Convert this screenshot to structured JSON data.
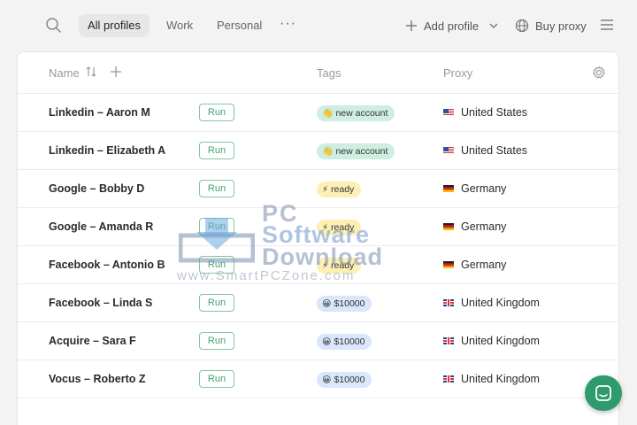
{
  "topbar": {
    "search_icon": "search-icon",
    "tabs": [
      {
        "label": "All profiles",
        "active": true
      },
      {
        "label": "Work",
        "active": false
      },
      {
        "label": "Personal",
        "active": false
      }
    ],
    "more_label": "···",
    "add_profile_label": "Add profile",
    "buy_proxy_label": "Buy proxy"
  },
  "table": {
    "columns": {
      "name": "Name",
      "tags": "Tags",
      "proxy": "Proxy"
    },
    "run_label": "Run",
    "rows": [
      {
        "name": "Linkedin – Aaron M",
        "tag": "new account",
        "tag_icon": "👋",
        "tag_color": "#cdeee0",
        "country": "United States",
        "flag": "us"
      },
      {
        "name": "Linkedin – Elizabeth A",
        "tag": "new account",
        "tag_icon": "👋",
        "tag_color": "#cdeee0",
        "country": "United States",
        "flag": "us"
      },
      {
        "name": "Google – Bobby D",
        "tag": "ready",
        "tag_icon": "⚡",
        "tag_color": "#fdf0b5",
        "country": "Germany",
        "flag": "de"
      },
      {
        "name": "Google – Amanda R",
        "tag": "ready",
        "tag_icon": "⚡",
        "tag_color": "#fdf0b5",
        "country": "Germany",
        "flag": "de"
      },
      {
        "name": "Facebook – Antonio B",
        "tag": "ready",
        "tag_icon": "⚡",
        "tag_color": "#fdf0b5",
        "country": "Germany",
        "flag": "de"
      },
      {
        "name": "Facebook – Linda S",
        "tag": "$10000",
        "tag_icon": "😀",
        "tag_color": "#d9e6fb",
        "country": "United Kingdom",
        "flag": "uk"
      },
      {
        "name": "Acquire – Sara F",
        "tag": "$10000",
        "tag_icon": "😀",
        "tag_color": "#d9e6fb",
        "country": "United Kingdom",
        "flag": "uk"
      },
      {
        "name": "Vocus – Roberto Z",
        "tag": "$10000",
        "tag_icon": "😀",
        "tag_color": "#d9e6fb",
        "country": "United Kingdom",
        "flag": "uk"
      }
    ]
  },
  "watermark": {
    "line1": "PC",
    "line2": "Software",
    "line3": "Download",
    "line4": "www.SmartPCZone.com"
  },
  "colors": {
    "accent": "#2f9a6d",
    "run_border": "#7fc7a4"
  }
}
